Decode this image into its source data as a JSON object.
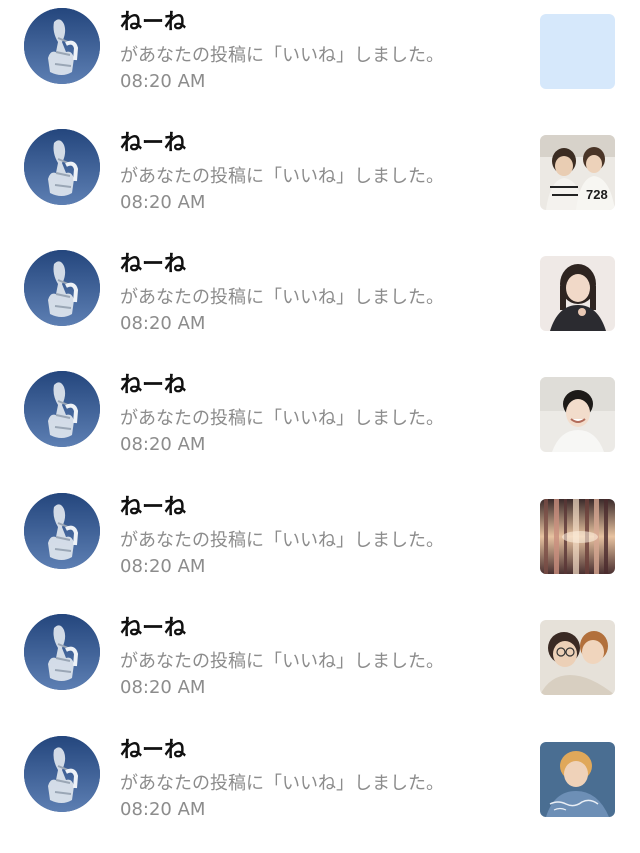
{
  "notifications": [
    {
      "user": "ねーね",
      "message": "があなたの投稿に「いいね」しました。",
      "time": "08:20 AM",
      "thumbnail": "blank-light-blue"
    },
    {
      "user": "ねーね",
      "message": "があなたの投稿に「いいね」しました。",
      "time": "08:20 AM",
      "thumbnail": "two-people-jersey-photo"
    },
    {
      "user": "ねーね",
      "message": "があなたの投稿に「いいね」しました。",
      "time": "08:20 AM",
      "thumbnail": "person-portrait-photo"
    },
    {
      "user": "ねーね",
      "message": "があなたの投稿に「いいね」しました。",
      "time": "08:20 AM",
      "thumbnail": "smiling-person-photo"
    },
    {
      "user": "ねーね",
      "message": "があなたの投稿に「いいね」しました。",
      "time": "08:20 AM",
      "thumbnail": "abstract-light-streaks-photo"
    },
    {
      "user": "ねーね",
      "message": "があなたの投稿に「いいね」しました。",
      "time": "08:20 AM",
      "thumbnail": "two-people-closeup-photo"
    },
    {
      "user": "ねーね",
      "message": "があなたの投稿に「いいね」しました。",
      "time": "08:20 AM",
      "thumbnail": "person-with-text-photo"
    }
  ],
  "colors": {
    "name": "#111111",
    "secondary_text": "#8c8c8c",
    "avatar_sky": "#2f4f86",
    "blank_thumb": "#d6e8fb"
  }
}
